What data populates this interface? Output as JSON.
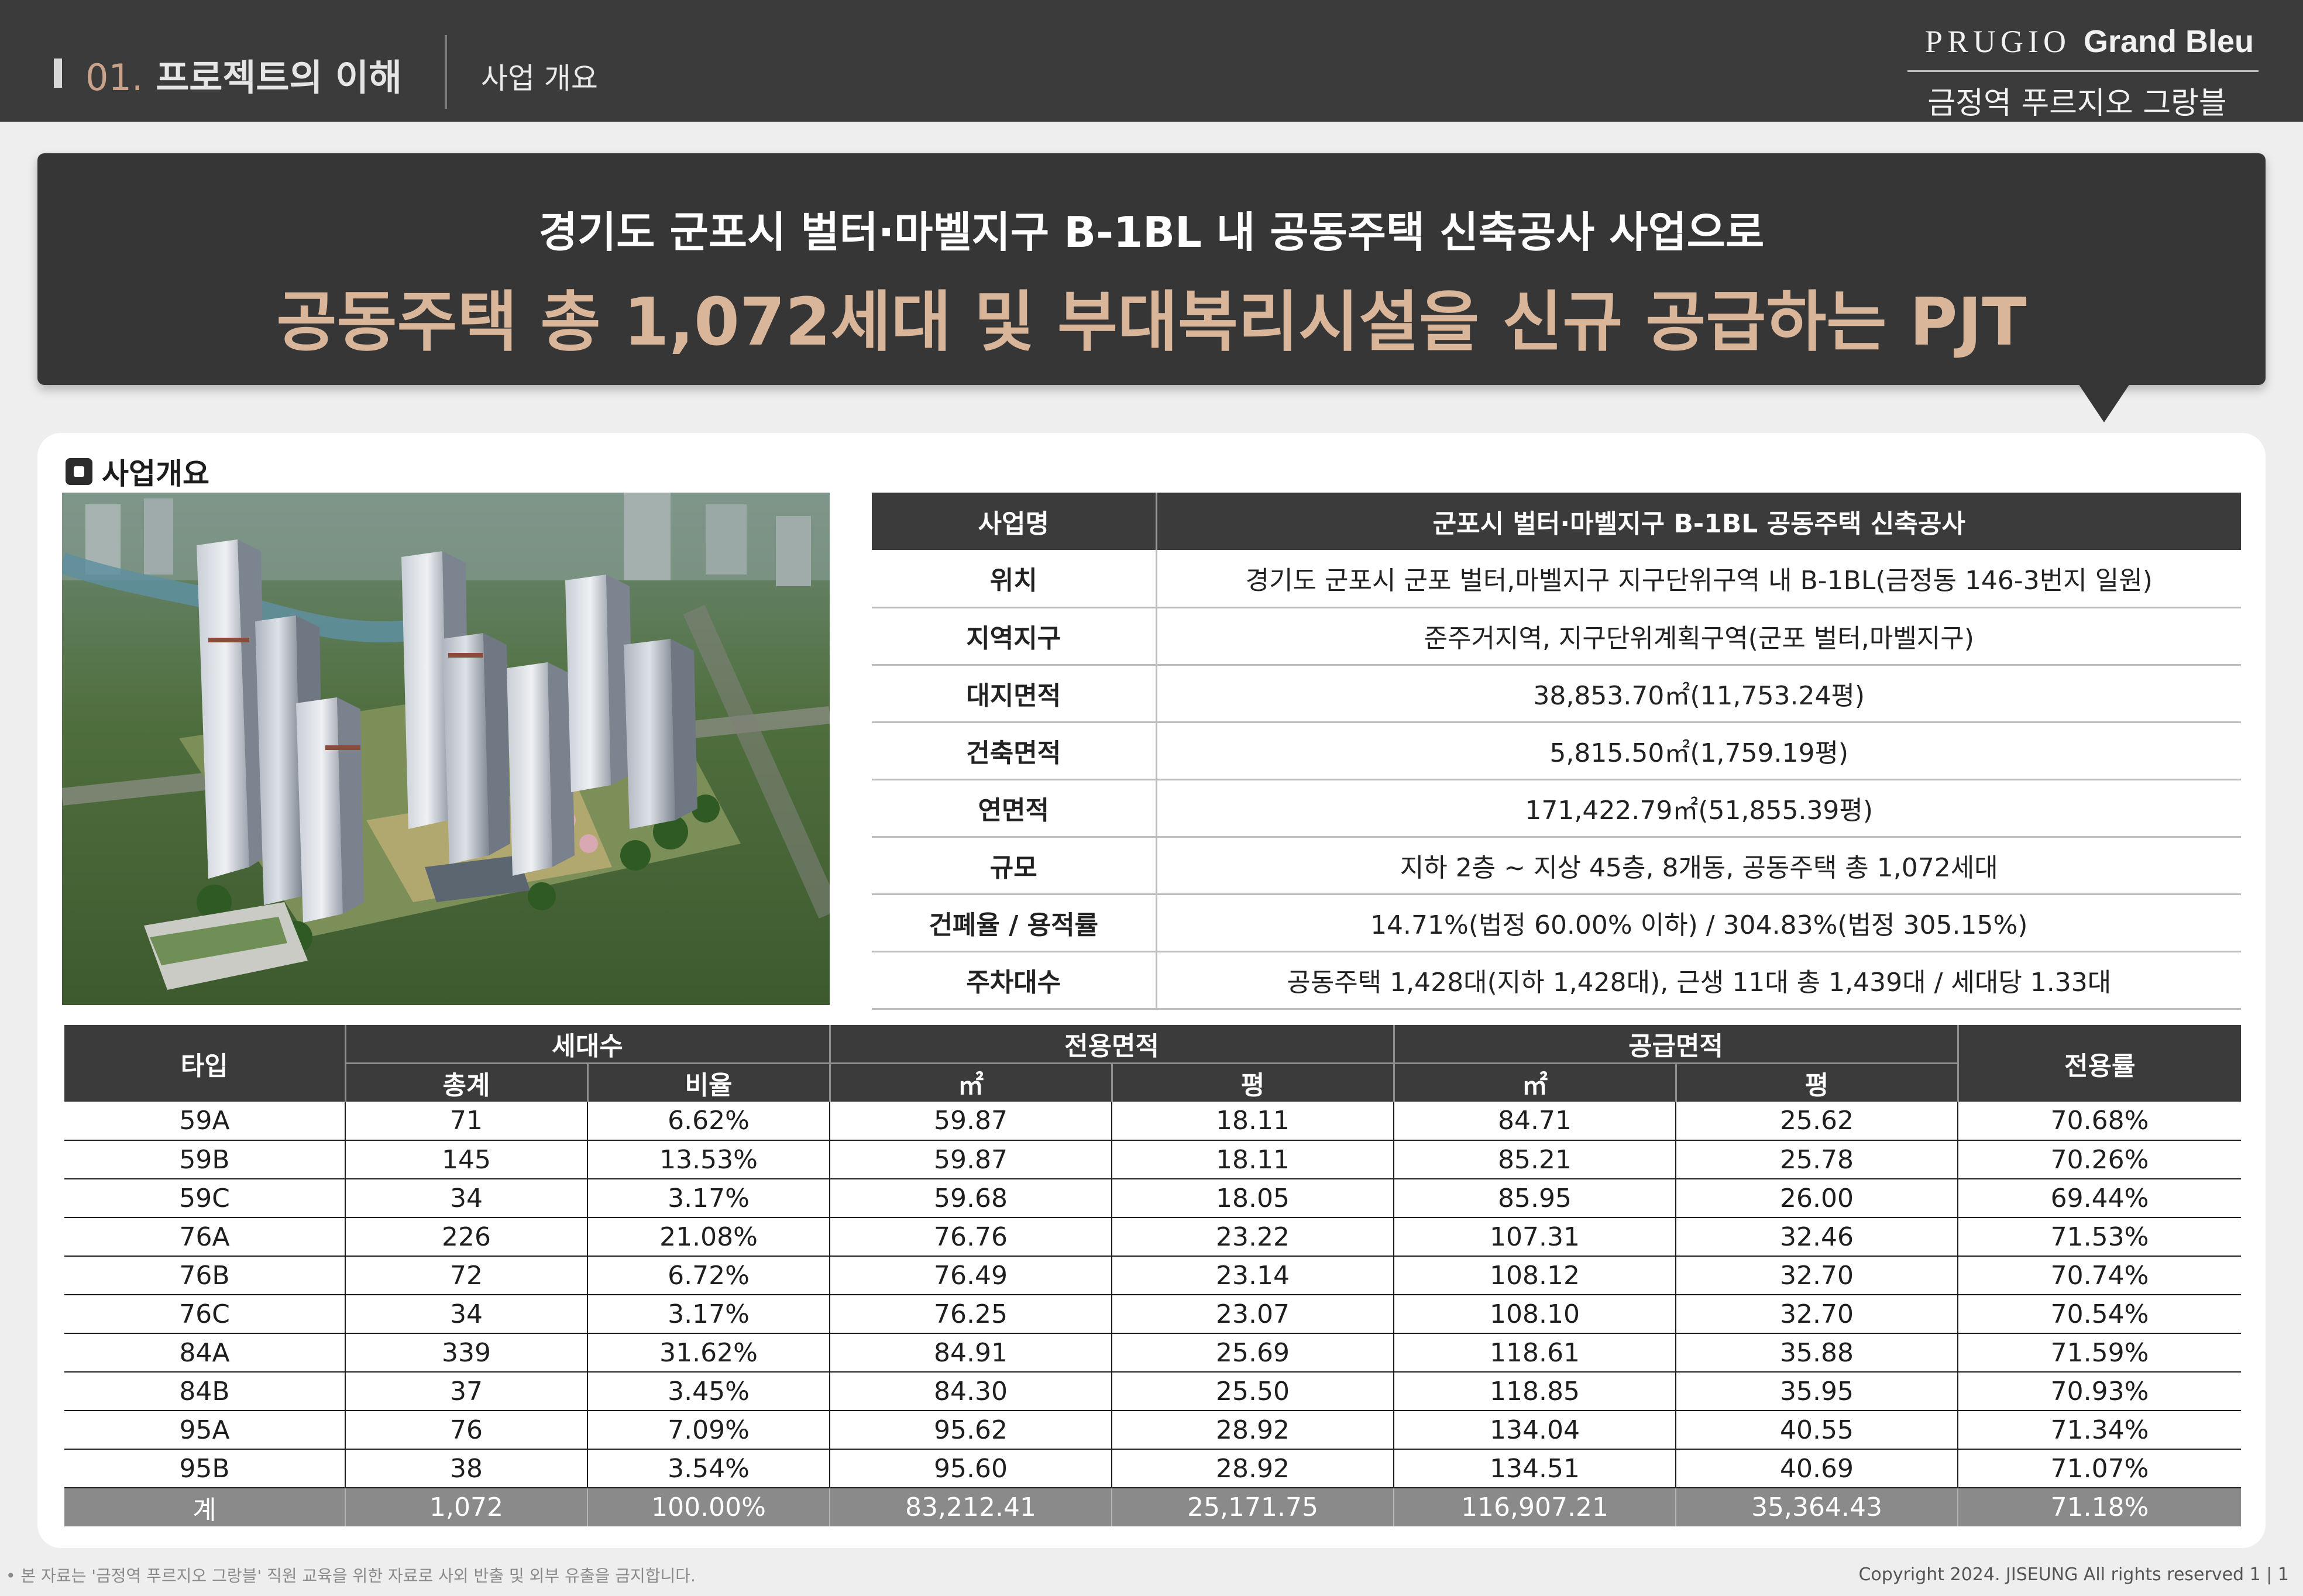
{
  "header": {
    "section_number": "01.",
    "section_title": "프로젝트의 이해",
    "sub_title": "사업 개요",
    "brand_prugio": "PRUGIO",
    "brand_grand": "Grand Bleu",
    "brand_korean": "금정역 푸르지오 그랑블"
  },
  "banner": {
    "line1": "경기도 군포시 벌터·마벨지구 B-1BL 내 공동주택 신축공사 사업으로",
    "line2": "공동주택 총 1,072세대 및 부대복리시설을 신규 공급하는 PJT"
  },
  "section": {
    "label": "사업개요"
  },
  "overview": [
    {
      "key": "사업명",
      "value": "군포시 벌터·마벨지구 B-1BL 공동주택 신축공사"
    },
    {
      "key": "위치",
      "value": "경기도 군포시 군포 벌터,마벨지구 지구단위구역 내 B-1BL(금정동 146-3번지 일원)"
    },
    {
      "key": "지역지구",
      "value": "준주거지역, 지구단위계획구역(군포 벌터,마벨지구)"
    },
    {
      "key": "대지면적",
      "value": "38,853.70㎡(11,753.24평)"
    },
    {
      "key": "건축면적",
      "value": "5,815.50㎡(1,759.19평)"
    },
    {
      "key": "연면적",
      "value": "171,422.79㎡(51,855.39평)"
    },
    {
      "key": "규모",
      "value": "지하 2층 ~ 지상 45층, 8개동, 공동주택 총 1,072세대"
    },
    {
      "key": "건폐율 / 용적률",
      "value": "14.71%(법정 60.00% 이하) / 304.83%(법정 305.15%)"
    },
    {
      "key": "주차대수",
      "value": "공동주택 1,428대(지하 1,428대), 근생 11대 총 1,439대 / 세대당 1.33대"
    }
  ],
  "type_table": {
    "headers": {
      "type": "타입",
      "households": "세대수",
      "exclusive_area": "전용면적",
      "supply_area": "공급면적",
      "ratio": "전용률",
      "total": "총계",
      "share": "비율",
      "sqm": "㎡",
      "pyeong": "평"
    },
    "rows": [
      [
        "59A",
        "71",
        "6.62%",
        "59.87",
        "18.11",
        "84.71",
        "25.62",
        "70.68%"
      ],
      [
        "59B",
        "145",
        "13.53%",
        "59.87",
        "18.11",
        "85.21",
        "25.78",
        "70.26%"
      ],
      [
        "59C",
        "34",
        "3.17%",
        "59.68",
        "18.05",
        "85.95",
        "26.00",
        "69.44%"
      ],
      [
        "76A",
        "226",
        "21.08%",
        "76.76",
        "23.22",
        "107.31",
        "32.46",
        "71.53%"
      ],
      [
        "76B",
        "72",
        "6.72%",
        "76.49",
        "23.14",
        "108.12",
        "32.70",
        "70.74%"
      ],
      [
        "76C",
        "34",
        "3.17%",
        "76.25",
        "23.07",
        "108.10",
        "32.70",
        "70.54%"
      ],
      [
        "84A",
        "339",
        "31.62%",
        "84.91",
        "25.69",
        "118.61",
        "35.88",
        "71.59%"
      ],
      [
        "84B",
        "37",
        "3.45%",
        "84.30",
        "25.50",
        "118.85",
        "35.95",
        "70.93%"
      ],
      [
        "95A",
        "76",
        "7.09%",
        "95.62",
        "28.92",
        "134.04",
        "40.55",
        "71.34%"
      ],
      [
        "95B",
        "38",
        "3.54%",
        "95.60",
        "28.92",
        "134.51",
        "40.69",
        "71.07%"
      ]
    ],
    "total_row": [
      "계",
      "1,072",
      "100.00%",
      "83,212.41",
      "25,171.75",
      "116,907.21",
      "35,364.43",
      "71.18%"
    ]
  },
  "footer": {
    "note": "• 본 자료는 '금정역 푸르지오 그랑블' 직원 교육을 위한 자료로 사외 반출 및 외부 유출을 금지합니다.",
    "copyright": "Copyright 2024. JISEUNG All rights reserved",
    "page": "1 | 1"
  },
  "colors": {
    "header_bg": "#3b3b3b",
    "accent_gold": "#d9b59a",
    "table_head_bg": "#3b3b3b",
    "total_row_bg": "#8a8a8a"
  },
  "icons": {
    "section_marker": "square-bullet-icon",
    "header_marker": "vertical-bar-icon"
  }
}
